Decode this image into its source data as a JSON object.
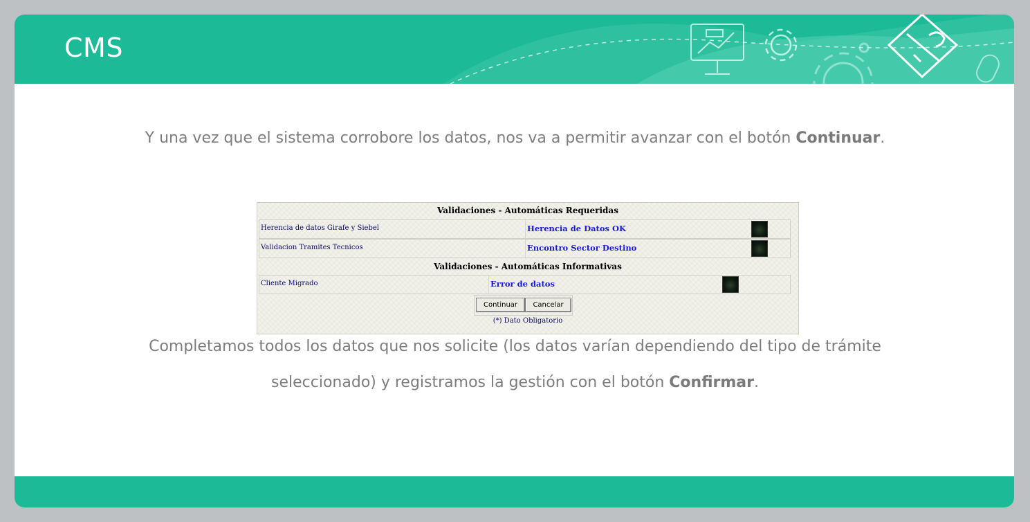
{
  "header": {
    "title": "CMS"
  },
  "intro": {
    "text": "Y una vez que el sistema corrobore los datos, nos va a permitir avanzar con el botón ",
    "bold": "Continuar",
    "end": "."
  },
  "form": {
    "section1_title": "Validaciones - Automáticas Requeridas",
    "section1_rows": [
      {
        "label": "Herencia de datos Girafe y Siebel",
        "value": "Herencia de Datos OK"
      },
      {
        "label": "Validacion Tramites Tecnicos",
        "value": "Encontro Sector Destino"
      }
    ],
    "section2_title": "Validaciones - Automáticas Informativas",
    "section2_rows": [
      {
        "label": "Cliente Migrado",
        "value": "Error de datos"
      }
    ],
    "continue_label": "Continuar",
    "cancel_label": "Cancelar",
    "required_note": "(*) Dato Obligatorio"
  },
  "outro": {
    "line1": "Completamos todos los datos que nos solicite (los datos varían dependiendo del tipo de trámite",
    "line2_start": "seleccionado) y registramos la gestión con el botón ",
    "line2_bold": "Confirmar",
    "line2_end": "."
  },
  "colors": {
    "accent": "#1dba97",
    "background": "#bdc1c4",
    "text": "#7d7d7d",
    "link_value": "#1a1ad6"
  }
}
